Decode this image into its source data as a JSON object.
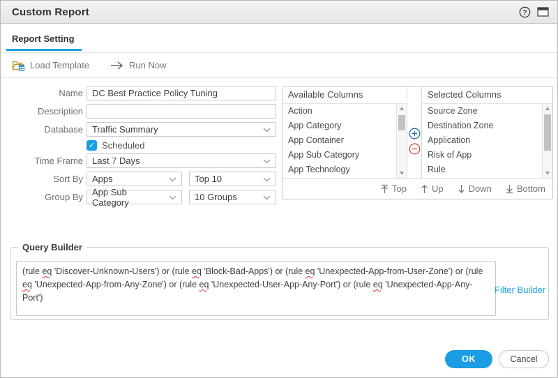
{
  "window": {
    "title": "Custom Report"
  },
  "tab": {
    "label": "Report Setting"
  },
  "toolbar": {
    "load_template": "Load Template",
    "run_now": "Run Now"
  },
  "icons": {
    "help": "?"
  },
  "form": {
    "name": {
      "label": "Name",
      "value": "DC Best Practice Policy Tuning"
    },
    "description": {
      "label": "Description",
      "value": ""
    },
    "database": {
      "label": "Database",
      "value": "Traffic Summary"
    },
    "scheduled": {
      "label": "Scheduled",
      "checked": true
    },
    "time_frame": {
      "label": "Time Frame",
      "value": "Last 7 Days"
    },
    "sort_by": {
      "label": "Sort By",
      "value": "Apps",
      "limit": "Top 10"
    },
    "group_by": {
      "label": "Group By",
      "value": "App Sub Category",
      "limit": "10 Groups"
    }
  },
  "columns": {
    "available": {
      "header": "Available Columns",
      "items": [
        "Action",
        "App Category",
        "App Container",
        "App Sub Category",
        "App Technology"
      ]
    },
    "selected": {
      "header": "Selected Columns",
      "items": [
        "Source Zone",
        "Destination Zone",
        "Application",
        "Risk of App",
        "Rule"
      ]
    },
    "actions": {
      "top": "Top",
      "up": "Up",
      "down": "Down",
      "bottom": "Bottom"
    }
  },
  "query_builder": {
    "legend": "Query Builder",
    "query": "(rule eq 'Discover-Unknown-Users') or (rule eq 'Block-Bad-Apps') or (rule eq 'Unexpected-App-from-User-Zone') or (rule eq 'Unexpected-App-from-Any-Zone') or (rule eq 'Unexpected-User-App-Any-Port') or (rule eq 'Unexpected-App-Any-Port')",
    "filter_builder": "Filter Builder"
  },
  "footer": {
    "ok": "OK",
    "cancel": "Cancel"
  },
  "colors": {
    "accent": "#1aa0e2",
    "ok_button": "#1b9de3",
    "add_circle": "#23739c",
    "remove_circle": "#c94b4d",
    "link": "#1aa0e2",
    "titlebar_bg": "#ececec"
  }
}
